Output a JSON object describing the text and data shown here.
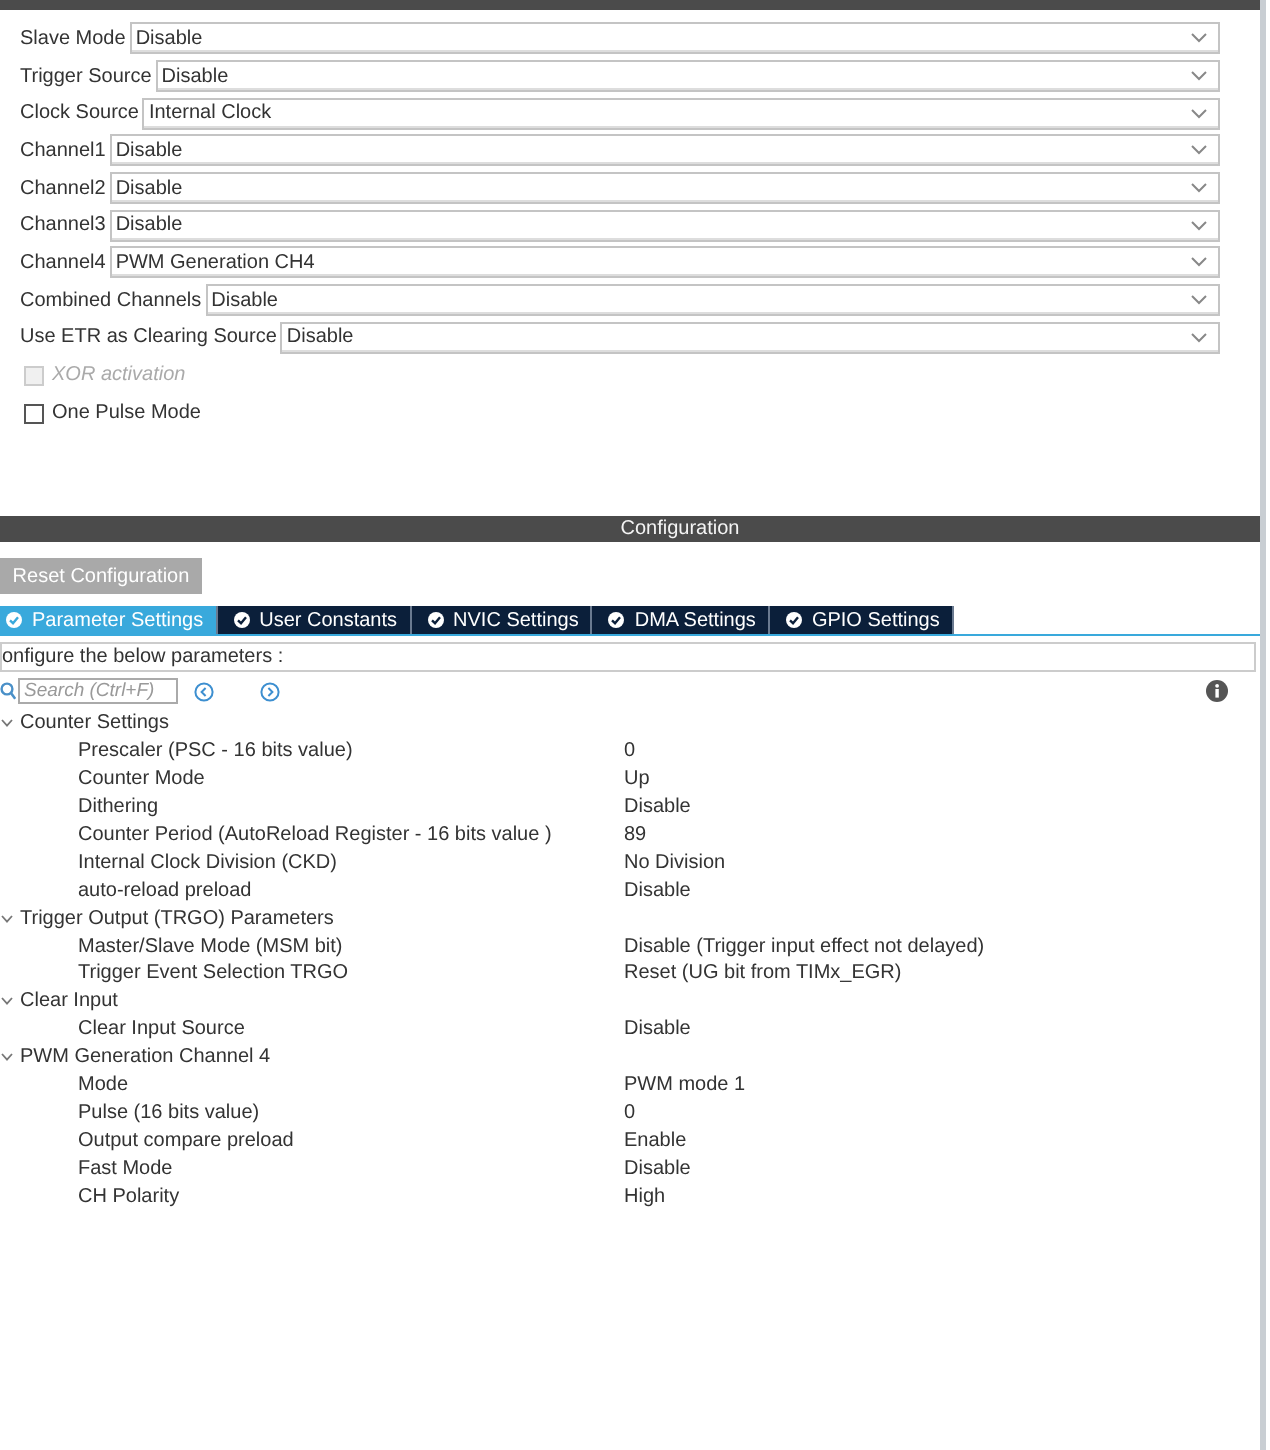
{
  "mode_panel": {
    "fields": [
      {
        "label": "Slave Mode",
        "value": "Disable"
      },
      {
        "label": "Trigger Source",
        "value": "Disable"
      },
      {
        "label": "Clock Source",
        "value": "Internal Clock"
      },
      {
        "label": "Channel1",
        "value": "Disable"
      },
      {
        "label": "Channel2",
        "value": "Disable"
      },
      {
        "label": "Channel3",
        "value": "Disable"
      },
      {
        "label": "Channel4",
        "value": "PWM Generation CH4"
      },
      {
        "label": "Combined Channels",
        "value": "Disable"
      },
      {
        "label": "Use ETR as Clearing Source",
        "value": "Disable"
      }
    ],
    "checkboxes": [
      {
        "label": "XOR activation",
        "checked": false,
        "disabled": true
      },
      {
        "label": "One Pulse Mode",
        "checked": false,
        "disabled": false
      }
    ]
  },
  "configuration": {
    "title": "Configuration",
    "reset_button": "Reset Configuration",
    "tabs": [
      {
        "label": "Parameter Settings",
        "selected": true
      },
      {
        "label": "User Constants",
        "selected": false
      },
      {
        "label": "NVIC Settings",
        "selected": false
      },
      {
        "label": "DMA Settings",
        "selected": false
      },
      {
        "label": "GPIO Settings",
        "selected": false
      }
    ],
    "description": "onfigure the below parameters :",
    "search": {
      "placeholder": "Search (Ctrl+F)"
    },
    "groups": [
      {
        "label": "Counter Settings",
        "expanded": true,
        "children": [
          {
            "name": "Prescaler (PSC - 16 bits value)",
            "value": "0"
          },
          {
            "name": "Counter Mode",
            "value": "Up"
          },
          {
            "name": "Dithering",
            "value": "Disable"
          },
          {
            "name": "Counter Period (AutoReload Register - 16 bits value )",
            "value": "89"
          },
          {
            "name": "Internal Clock Division (CKD)",
            "value": "No Division"
          },
          {
            "name": "auto-reload preload",
            "value": "Disable"
          }
        ]
      },
      {
        "label": "Trigger Output (TRGO) Parameters",
        "expanded": true,
        "children": [
          {
            "name": "Master/Slave Mode (MSM bit)",
            "value": "Disable (Trigger input effect not delayed)"
          },
          {
            "name": "Trigger Event Selection TRGO",
            "value": "Reset (UG bit from TIMx_EGR)"
          }
        ]
      },
      {
        "label": "Clear Input",
        "expanded": true,
        "children": [
          {
            "name": "Clear Input Source",
            "value": "Disable"
          }
        ]
      },
      {
        "label": "PWM Generation Channel 4",
        "expanded": true,
        "children": [
          {
            "name": "Mode",
            "value": "PWM mode 1"
          },
          {
            "name": "Pulse (16 bits value)",
            "value": "0"
          },
          {
            "name": "Output compare preload",
            "value": "Enable"
          },
          {
            "name": "Fast Mode",
            "value": "Disable"
          },
          {
            "name": "CH Polarity",
            "value": "High"
          }
        ]
      }
    ]
  }
}
